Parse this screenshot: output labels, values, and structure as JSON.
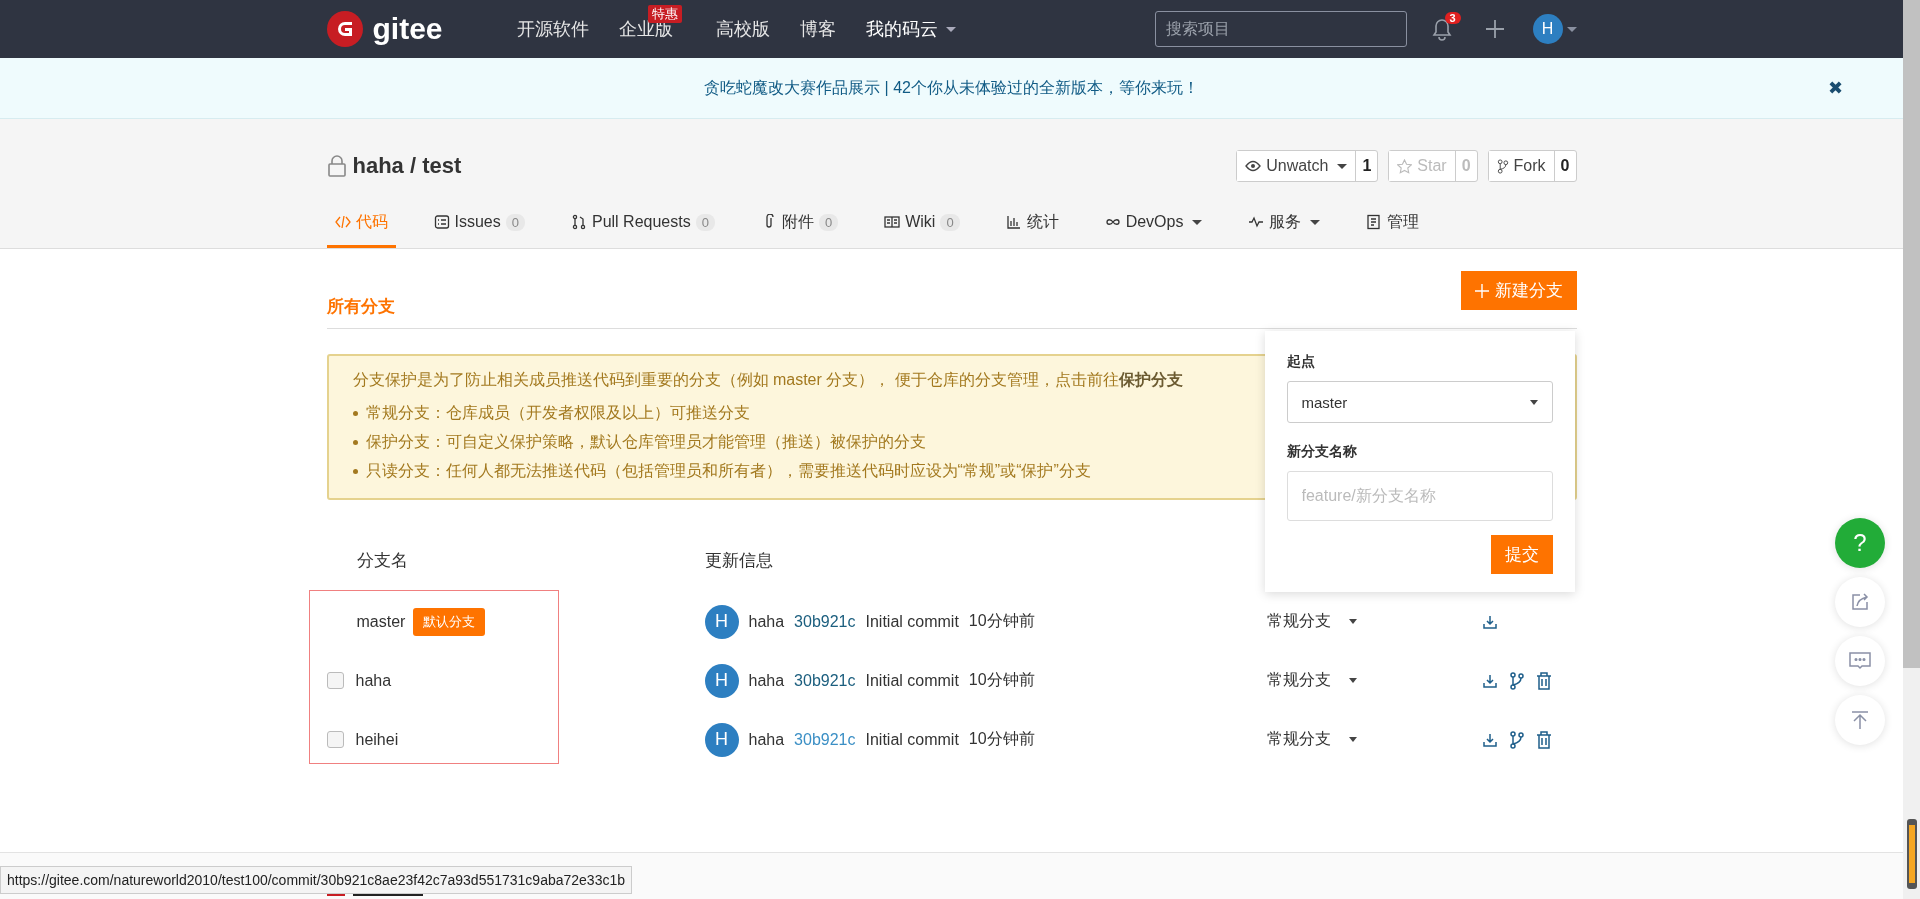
{
  "nav": {
    "logo": "gitee",
    "items": [
      {
        "label": "开源软件",
        "dropdown": false
      },
      {
        "label": "企业版",
        "badge": "特惠",
        "dropdown": false
      },
      {
        "label": "高校版",
        "dropdown": false
      },
      {
        "label": "博客",
        "dropdown": false
      },
      {
        "label": "我的码云",
        "dropdown": true
      }
    ],
    "search": {
      "placeholder": "搜索项目"
    },
    "notifications": "3",
    "avatar": "H"
  },
  "banner": {
    "text": "贪吃蛇魔改大赛作品展示 | 42个你从未体验过的全新版本，等你来玩！",
    "close": "✖"
  },
  "repo": {
    "title": "haha / test",
    "actions": [
      {
        "label": "Unwatch",
        "dropdown": true,
        "count": "1",
        "disabled": false
      },
      {
        "label": "Star",
        "dropdown": false,
        "count": "0",
        "disabled": true
      },
      {
        "label": "Fork",
        "dropdown": false,
        "count": "0",
        "disabled": false
      }
    ]
  },
  "tabs": [
    {
      "label": "代码",
      "dropdown": false,
      "selected": true
    },
    {
      "label": "Issues",
      "count": "0",
      "dropdown": false,
      "selected": false
    },
    {
      "label": "Pull Requests",
      "count": "0",
      "dropdown": false,
      "selected": false
    },
    {
      "label": "附件",
      "count": "0",
      "dropdown": false,
      "selected": false
    },
    {
      "label": "Wiki",
      "count": "0",
      "dropdown": false,
      "selected": false
    },
    {
      "label": "统计",
      "dropdown": false,
      "selected": false
    },
    {
      "label": "DevOps",
      "dropdown": true,
      "selected": false
    },
    {
      "label": "服务",
      "dropdown": true,
      "selected": false
    },
    {
      "label": "管理",
      "dropdown": false,
      "selected": false
    }
  ],
  "section_title": "所有分支",
  "new_branch_button": "新建分支",
  "notice": {
    "intro": "分支保护是为了防止相关成员推送代码到重要的分支（例如 master 分支）， 便于仓库的分支管理，点击前往**保护分支**",
    "bullets": [
      "常规分支：仓库成员（开发者权限及以上）可推送分支",
      "保护分支：可自定义保护策略，默认仓库管理员才能管理（推送）被保护的分支",
      "只读分支：任何人都无法推送代码（包括管理员和所有者），需要推送代码时应设为“常规”或“保护”分支"
    ]
  },
  "popup": {
    "start_label": "起点",
    "start_value": "master",
    "name_label": "新分支名称",
    "name_placeholder": "feature/新分支名称",
    "submit": "提交"
  },
  "table": {
    "columns": [
      "分支名",
      "更新信息"
    ],
    "rows": [
      {
        "name": "master",
        "badge": "默认分支",
        "avatar": "H",
        "author": "haha",
        "commit": "30b921c",
        "commit_hovered": false,
        "message": "Initial commit",
        "time": "10分钟前",
        "type": "常规分支",
        "actions": [
          {
            "kind": "download"
          }
        ]
      },
      {
        "name": "haha",
        "checked": false,
        "avatar": "H",
        "author": "haha",
        "commit": "30b921c",
        "commit_hovered": false,
        "message": "Initial commit",
        "time": "10分钟前",
        "type": "常规分支",
        "actions": [
          {
            "kind": "download"
          },
          {
            "kind": "branch"
          },
          {
            "kind": "delete"
          }
        ]
      },
      {
        "name": "heihei",
        "checked": false,
        "avatar": "H",
        "author": "haha",
        "commit": "30b921c",
        "commit_hovered": true,
        "message": "Initial commit",
        "time": "10分钟前",
        "type": "常规分支",
        "actions": [
          {
            "kind": "download"
          },
          {
            "kind": "branch"
          },
          {
            "kind": "delete"
          }
        ]
      }
    ]
  },
  "side_buttons": [
    {
      "kind": "help",
      "label": "?"
    },
    {
      "kind": "share"
    },
    {
      "kind": "comment"
    },
    {
      "kind": "top"
    }
  ],
  "status_url": "https://gitee.com/natureworld2010/test100/commit/30b921c8ae23f42c7a93d551731c9aba72e33c1b"
}
